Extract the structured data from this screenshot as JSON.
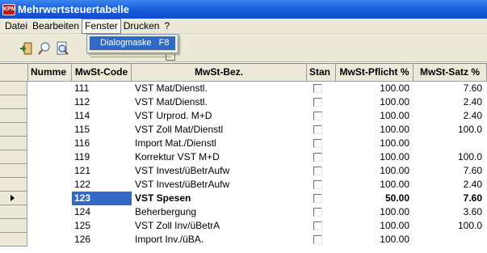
{
  "window": {
    "icon_text": "KPM",
    "title": "Mehrwertsteuertabelle"
  },
  "menu": {
    "items": [
      {
        "label": "Datei"
      },
      {
        "label": "Bearbeiten"
      },
      {
        "label": "Fenster"
      },
      {
        "label": "Drucken"
      },
      {
        "label": "?"
      }
    ],
    "fenster_dropdown": {
      "label": "Dialogmaske",
      "shortcut": "F8"
    }
  },
  "toolbar": {
    "buttons": [
      {
        "icon": "exit-icon"
      },
      {
        "icon": "search-icon"
      },
      {
        "icon": "print-preview-icon"
      }
    ]
  },
  "table": {
    "headers": {
      "nummer": "Numme",
      "code": "MwSt-Code",
      "bez": "MwSt-Bez.",
      "stan": "Stan",
      "pflicht": "MwSt-Pflicht %",
      "satz": "MwSt-Satz %"
    },
    "rows": [
      {
        "code": "111",
        "bez": "VST Mat/Dienstl.",
        "pflicht": "100.00",
        "satz": "7.60",
        "current": false
      },
      {
        "code": "112",
        "bez": "VST Mat/Dienstl.",
        "pflicht": "100.00",
        "satz": "2.40",
        "current": false
      },
      {
        "code": "114",
        "bez": "VST Urprod. M+D",
        "pflicht": "100.00",
        "satz": "2.40",
        "current": false
      },
      {
        "code": "115",
        "bez": "VST Zoll Mat/Dienstl",
        "pflicht": "100.00",
        "satz": "100.0",
        "current": false
      },
      {
        "code": "116",
        "bez": "Import Mat./Dienstl",
        "pflicht": "100.00",
        "satz": "",
        "current": false
      },
      {
        "code": "119",
        "bez": "Korrektur VST M+D",
        "pflicht": "100.00",
        "satz": "100.0",
        "current": false
      },
      {
        "code": "121",
        "bez": "VST Invest/üBetrAufw",
        "pflicht": "100.00",
        "satz": "7.60",
        "current": false
      },
      {
        "code": "122",
        "bez": "VST Invest/üBetrAufw",
        "pflicht": "100.00",
        "satz": "2.40",
        "current": false
      },
      {
        "code": "123",
        "bez": "VST Spesen",
        "pflicht": "50.00",
        "satz": "7.60",
        "current": true
      },
      {
        "code": "124",
        "bez": "Beherbergung",
        "pflicht": "100.00",
        "satz": "3.60",
        "current": false
      },
      {
        "code": "125",
        "bez": "VST Zoll Inv/üBetrA",
        "pflicht": "100.00",
        "satz": "100.0",
        "current": false
      },
      {
        "code": "126",
        "bez": "Import Inv./üBA.",
        "pflicht": "100.00",
        "satz": "",
        "current": false
      }
    ]
  }
}
